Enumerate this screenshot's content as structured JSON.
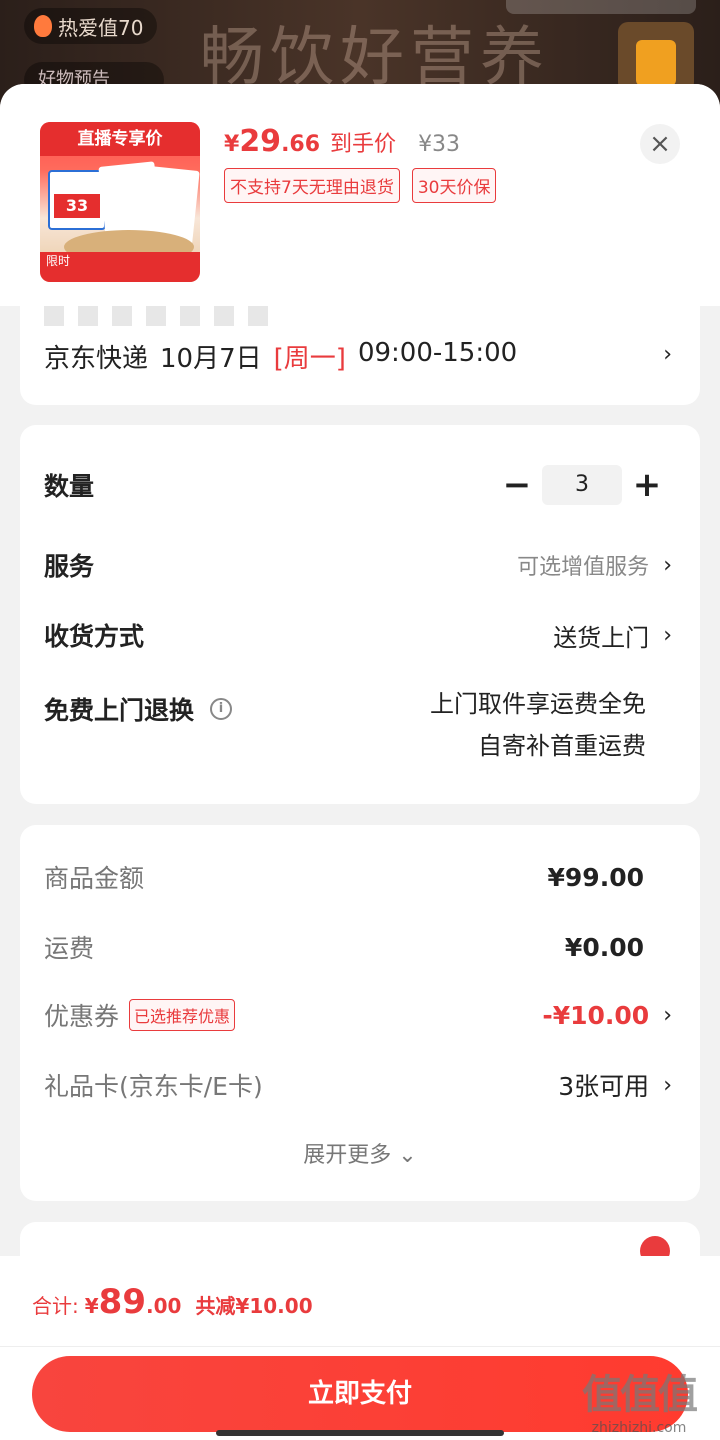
{
  "background": {
    "live_chip": "热爱值70",
    "live_chip2": "好物预告",
    "live_title": "畅饮好营养"
  },
  "product": {
    "image_tag": "直播专享价",
    "image_price": "33",
    "image_limit": "限时",
    "price_currency": "¥",
    "price_int": "29",
    "price_dec": ".66",
    "price_label": "到手价",
    "original_price": "¥33",
    "tag_no_return": "不支持7天无理由退货",
    "tag_price_protect": "30天价保"
  },
  "delivery": {
    "carrier": "京东快递",
    "date": "10月7日",
    "weekday": "[周一]",
    "time": "09:00-15:00"
  },
  "options": {
    "quantity_label": "数量",
    "quantity_minus": "−",
    "quantity_value": "3",
    "quantity_plus": "+",
    "service_label": "服务",
    "service_value": "可选增值服务",
    "receive_label": "收货方式",
    "receive_value": "送货上门",
    "free_return_label": "免费上门退换",
    "free_return_line1": "上门取件享运费全免",
    "free_return_line2": "自寄补首重运费"
  },
  "costs": {
    "goods_label": "商品金额",
    "goods_value": "¥99.00",
    "shipping_label": "运费",
    "shipping_value": "¥0.00",
    "coupon_label": "优惠券",
    "coupon_tag": "已选推荐优惠",
    "coupon_value": "-¥10.00",
    "giftcard_label": "礼品卡(京东卡/E卡)",
    "giftcard_value": "3张可用",
    "expand_label": "展开更多"
  },
  "footer": {
    "total_label": "合计:",
    "total_currency": "¥",
    "total_int": "89",
    "total_dec": ".00",
    "saved": "共减¥10.00",
    "pay_label": "立即支付"
  },
  "watermark": {
    "big": "值值值",
    "small": "zhizhizhi.com"
  },
  "colors": {
    "accent": "#e93b3d",
    "pay_button": "#f8453e",
    "page_bg": "#f2f2f2"
  }
}
